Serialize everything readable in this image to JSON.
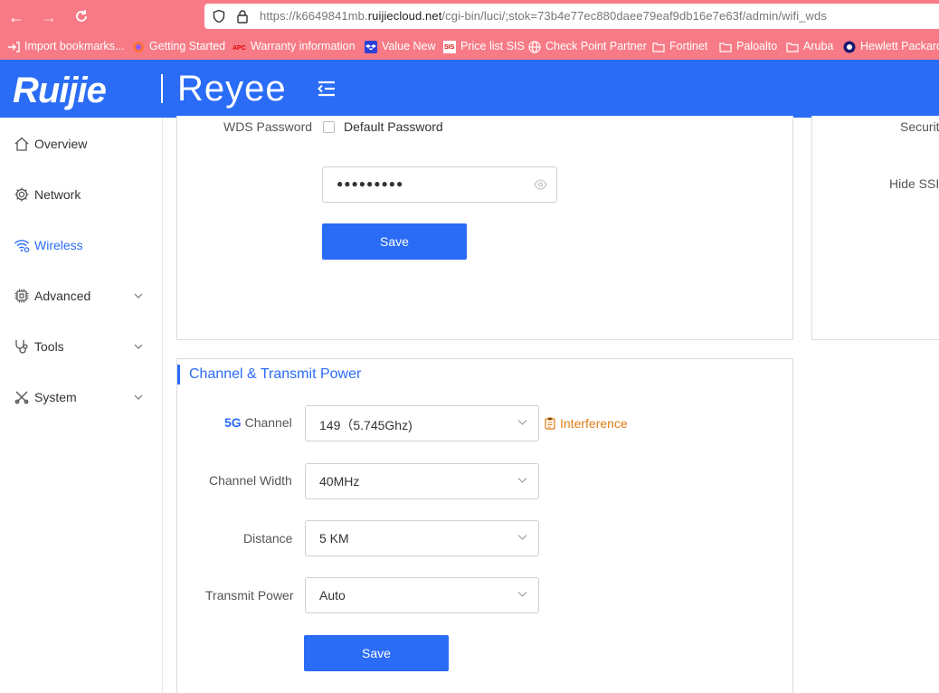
{
  "browser": {
    "url_prefix": "https://k6649841mb.",
    "url_domain": "ruijiecloud.net",
    "url_suffix": "/cgi-bin/luci/;stok=73b4e77ec880daee79eaf9db16e7e63f/admin/wifi_wds",
    "bookmarks": [
      "Import bookmarks...",
      "Getting Started",
      "Warranty information",
      "Value New",
      "Price list SIS",
      "Check Point Partner",
      "Fortinet",
      "Paloalto",
      "Aruba",
      "Hewlett Packard"
    ]
  },
  "header": {
    "logo_left": "Ruijie",
    "logo_right": "Reyee"
  },
  "sidebar": {
    "items": [
      {
        "label": "Overview",
        "icon": "home-icon"
      },
      {
        "label": "Network",
        "icon": "gear-icon"
      },
      {
        "label": "Wireless",
        "icon": "wifi-icon",
        "active": true
      },
      {
        "label": "Advanced",
        "icon": "chip-icon",
        "expandable": true
      },
      {
        "label": "Tools",
        "icon": "stethoscope-icon",
        "expandable": true
      },
      {
        "label": "System",
        "icon": "tools-icon",
        "expandable": true
      }
    ]
  },
  "wds": {
    "password_label": "WDS Password",
    "default_password_label": "Default Password",
    "password_value": "●●●●●●●●●",
    "save_label": "Save"
  },
  "right_card": {
    "security_label": "Securit",
    "hide_ssid_label": "Hide SSI"
  },
  "channel": {
    "title": "Channel & Transmit Power",
    "band_prefix": "5G",
    "channel_label": " Channel",
    "channel_value": "149（5.745Ghz)",
    "interference_label": "Interference",
    "width_label": "Channel Width",
    "width_value": "40MHz",
    "distance_label": "Distance",
    "distance_value": "5 KM",
    "power_label": "Transmit Power",
    "power_value": "Auto",
    "save_label": "Save"
  },
  "colors": {
    "brand": "#2a6cf6",
    "browser": "#f77b86",
    "warning": "#e07b13"
  }
}
